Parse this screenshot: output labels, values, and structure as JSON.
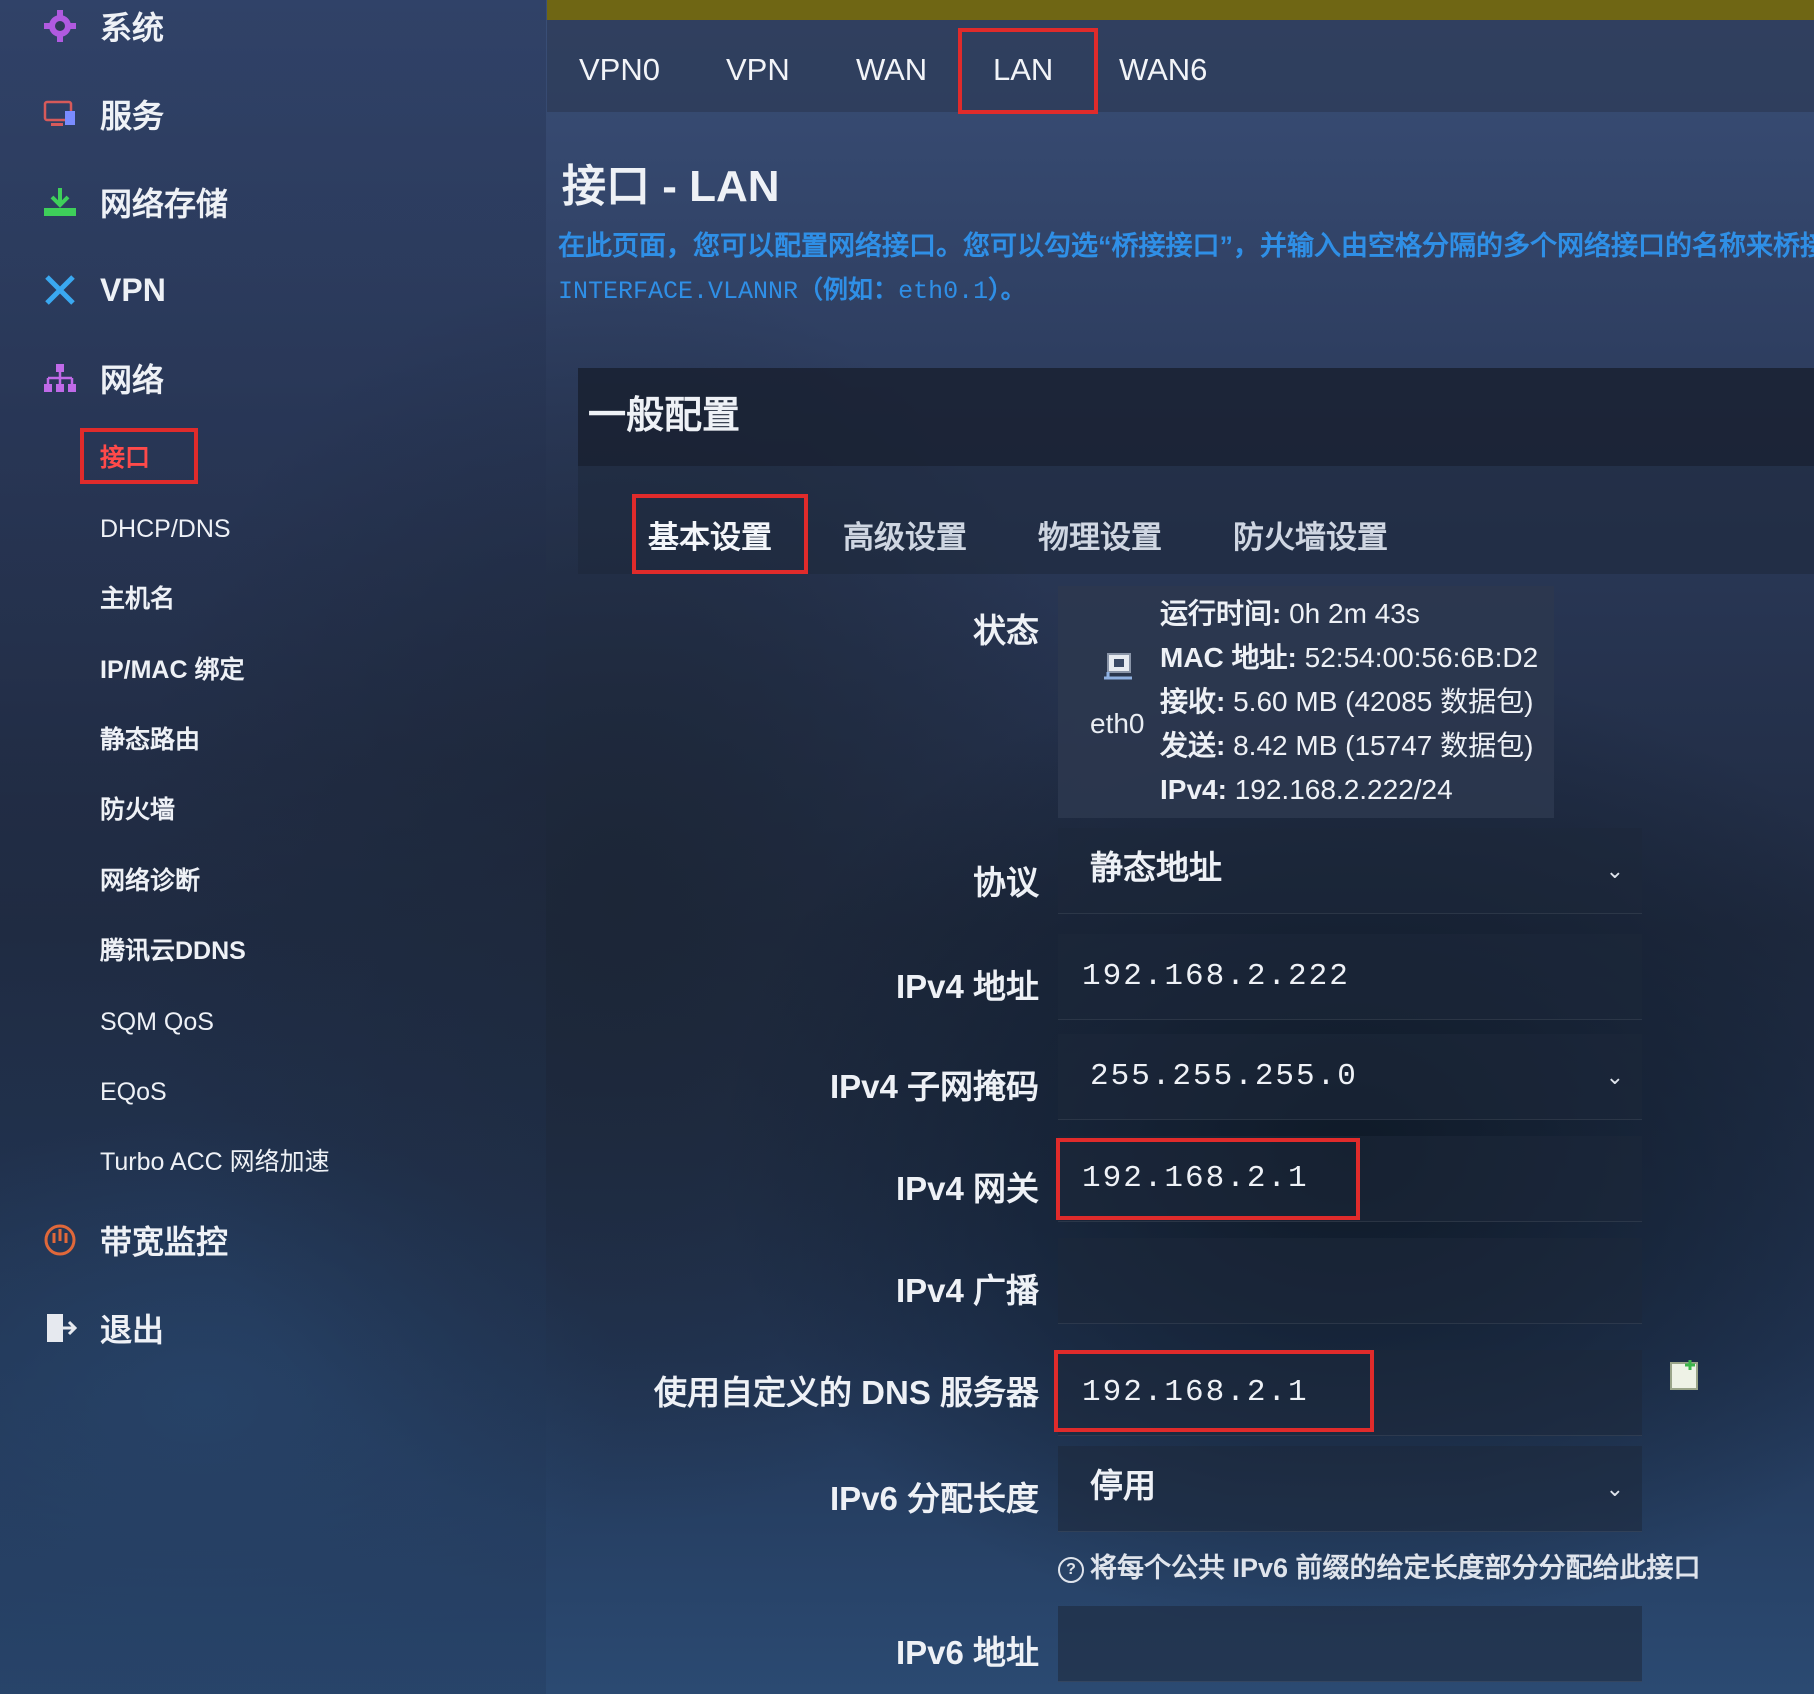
{
  "sidebar": {
    "items": [
      {
        "label": "系统",
        "icon": "gear-icon"
      },
      {
        "label": "服务",
        "icon": "services-icon"
      },
      {
        "label": "网络存储",
        "icon": "download-storage-icon"
      },
      {
        "label": "VPN",
        "icon": "vpn-icon"
      },
      {
        "label": "网络",
        "icon": "network-icon"
      },
      {
        "label": "带宽监控",
        "icon": "bandwidth-icon"
      },
      {
        "label": "退出",
        "icon": "logout-icon"
      }
    ],
    "network_sub": [
      "接口",
      "DHCP/DNS",
      "主机名",
      "IP/MAC 绑定",
      "静态路由",
      "防火墙",
      "网络诊断",
      "腾讯云DDNS",
      "SQM QoS",
      "EQoS",
      "Turbo ACC 网络加速"
    ]
  },
  "tabs": [
    "VPN0",
    "VPN",
    "WAN",
    "LAN",
    "WAN6"
  ],
  "page": {
    "title": "接口 - LAN",
    "desc_line1": "在此页面，您可以配置网络接口。您可以勾选“桥接接口”，并输入由空格分隔的多个网络接口的名称来桥接多个接口。接口名称中也可以使用",
    "desc_mono1": "INTERFACE.VLANNR",
    "desc_cn": "（例如：",
    "desc_mono2": "eth0.1",
    "desc_end": "）。"
  },
  "panel": {
    "title": "一般配置",
    "subtabs": [
      "基本设置",
      "高级设置",
      "物理设置",
      "防火墙设置"
    ]
  },
  "form": {
    "status_label": "状态",
    "status": {
      "iface": "eth0",
      "uptime_k": "运行时间:",
      "uptime_v": " 0h 2m 43s",
      "mac_k": "MAC 地址:",
      "mac_v": " 52:54:00:56:6B:D2",
      "rx_k": "接收:",
      "rx_v": " 5.60 MB (42085 数据包)",
      "tx_k": "发送:",
      "tx_v": " 8.42 MB (15747 数据包)",
      "ipv4_k": "IPv4:",
      "ipv4_v": " 192.168.2.222/24"
    },
    "protocol_label": "协议",
    "protocol_value": "静态地址",
    "ipv4_addr_label": "IPv4 地址",
    "ipv4_addr_value": "192.168.2.222",
    "netmask_label": "IPv4 子网掩码",
    "netmask_value": "255.255.255.0",
    "gateway_label": "IPv4 网关",
    "gateway_value": "192.168.2.1",
    "broadcast_label": "IPv4 广播",
    "broadcast_value": "",
    "dns_label": "使用自定义的 DNS 服务器",
    "dns_value": "192.168.2.1",
    "ip6assign_label": "IPv6 分配长度",
    "ip6assign_value": "停用",
    "ip6assign_hint": "将每个公共 IPv6 前缀的给定长度部分分配给此接口",
    "ipv6_addr_label": "IPv6 地址",
    "ipv6_addr_value": ""
  },
  "colors": {
    "highlight_border": "#e02b2b",
    "link_blue": "#2f8fe6",
    "top_bar": "#6f6614"
  }
}
